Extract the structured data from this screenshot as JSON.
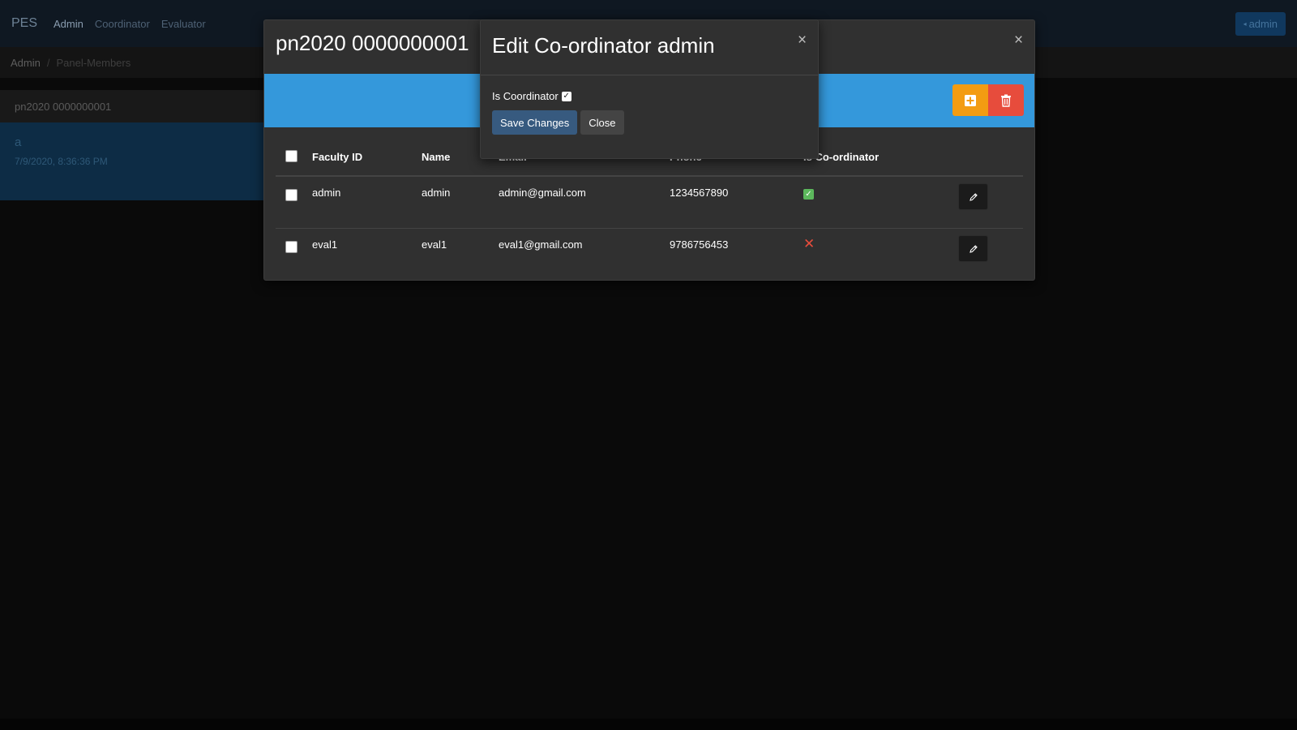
{
  "navbar": {
    "brand": "PES",
    "links": [
      "Admin",
      "Coordinator",
      "Evaluator"
    ],
    "user_label": "admin",
    "user_icon": "caret-left-icon"
  },
  "breadcrumb": {
    "items": [
      "Admin",
      "Panel-Members"
    ],
    "separator": "/"
  },
  "panel_list": {
    "header": "pn2020 0000000001",
    "item_letter": "a",
    "item_date": "7/9/2020, 8:36:36 PM"
  },
  "main_modal": {
    "title": "pn2020 0000000001",
    "close_symbol": "×",
    "add_icon": "plus-square-icon",
    "delete_icon": "trash-icon",
    "colors": {
      "band": "#3498db",
      "add": "#f39c12",
      "delete": "#e74c3c"
    },
    "table": {
      "headers": [
        "Faculty ID",
        "Name",
        "Email",
        "Phone",
        "Is Co-ordinator"
      ],
      "rows": [
        {
          "faculty_id": "admin",
          "name": "admin",
          "email": "admin@gmail.com",
          "phone": "1234567890",
          "is_coordinator": true,
          "status_icon": "check-icon"
        },
        {
          "faculty_id": "eval1",
          "name": "eval1",
          "email": "eval1@gmail.com",
          "phone": "9786756453",
          "is_coordinator": false,
          "status_icon": "cross-icon"
        }
      ],
      "row_action_icon": "pencil-icon"
    }
  },
  "edit_modal": {
    "title": "Edit Co-ordinator admin",
    "close_symbol": "×",
    "field_label": "Is Coordinator",
    "field_checked": true,
    "save_label": "Save Changes",
    "close_label": "Close",
    "colors": {
      "primary": "#375a7f",
      "secondary": "#444444"
    }
  }
}
